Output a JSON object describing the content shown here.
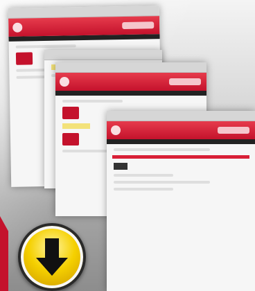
{
  "scene": {
    "description_colors": {
      "brand_red": "#c4122c",
      "download_yellow": "#f5d000"
    },
    "icons": [
      "download-arrow-icon"
    ]
  }
}
